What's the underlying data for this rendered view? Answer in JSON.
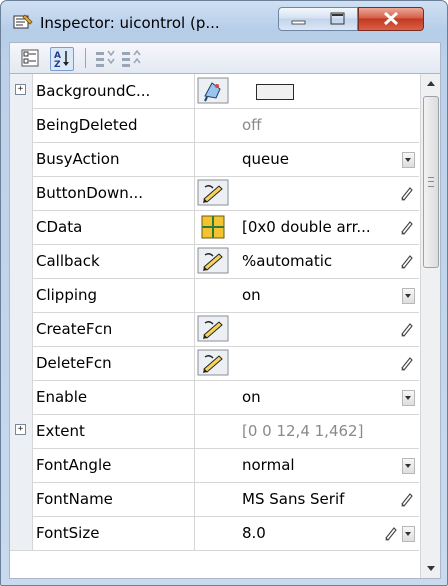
{
  "window": {
    "title": "Inspector:  uicontrol (p...",
    "controls": [
      "minimize-icon",
      "maximize-icon",
      "close-icon"
    ]
  },
  "toolbar": {
    "buttons": [
      {
        "name": "categorized-view-icon",
        "active": false
      },
      {
        "name": "sort-alphabetical-icon",
        "active": true
      },
      {
        "name": "expand-all-icon",
        "active": false
      },
      {
        "name": "collapse-all-icon",
        "active": false
      }
    ]
  },
  "properties": [
    {
      "name": "BackgroundC...",
      "value": "",
      "expandable": true,
      "icon": "color-picker-icon",
      "swatch": "#f0f0f0",
      "control": "none",
      "dim": false
    },
    {
      "name": "BeingDeleted",
      "value": "off",
      "expandable": false,
      "icon": "",
      "control": "none",
      "dim": true
    },
    {
      "name": "BusyAction",
      "value": "queue",
      "expandable": false,
      "icon": "",
      "control": "dropdown",
      "dim": false
    },
    {
      "name": "ButtonDown...",
      "value": "",
      "expandable": false,
      "icon": "callback-editor-icon",
      "control": "edit",
      "dim": false
    },
    {
      "name": "CData",
      "value": "[0x0  double arr...",
      "expandable": false,
      "icon": "array-editor-icon",
      "control": "edit",
      "dim": false
    },
    {
      "name": "Callback",
      "value": "%automatic",
      "expandable": false,
      "icon": "callback-editor-icon",
      "control": "edit",
      "dim": false
    },
    {
      "name": "Clipping",
      "value": "on",
      "expandable": false,
      "icon": "",
      "control": "dropdown",
      "dim": false
    },
    {
      "name": "CreateFcn",
      "value": "",
      "expandable": false,
      "icon": "callback-editor-icon",
      "control": "edit",
      "dim": false
    },
    {
      "name": "DeleteFcn",
      "value": "",
      "expandable": false,
      "icon": "callback-editor-icon",
      "control": "edit",
      "dim": false
    },
    {
      "name": "Enable",
      "value": "on",
      "expandable": false,
      "icon": "",
      "control": "dropdown",
      "dim": false
    },
    {
      "name": "Extent",
      "value": "[0 0 12,4 1,462]",
      "expandable": true,
      "icon": "",
      "control": "none",
      "dim": true
    },
    {
      "name": "FontAngle",
      "value": "normal",
      "expandable": false,
      "icon": "",
      "control": "dropdown",
      "dim": false
    },
    {
      "name": "FontName",
      "value": "MS Sans Serif",
      "expandable": false,
      "icon": "",
      "control": "edit",
      "dim": false
    },
    {
      "name": "FontSize",
      "value": "8.0",
      "expandable": false,
      "icon": "",
      "control": "edit-dropdown",
      "dim": false
    }
  ],
  "colors": {
    "grid_line": "#d6d6d6",
    "dim_text": "#8a8a8a",
    "swatch": "#f0f0f0"
  },
  "scrollbar": {
    "position_fraction": 0.0,
    "icons": [
      "scroll-up-icon",
      "scroll-down-icon"
    ]
  }
}
